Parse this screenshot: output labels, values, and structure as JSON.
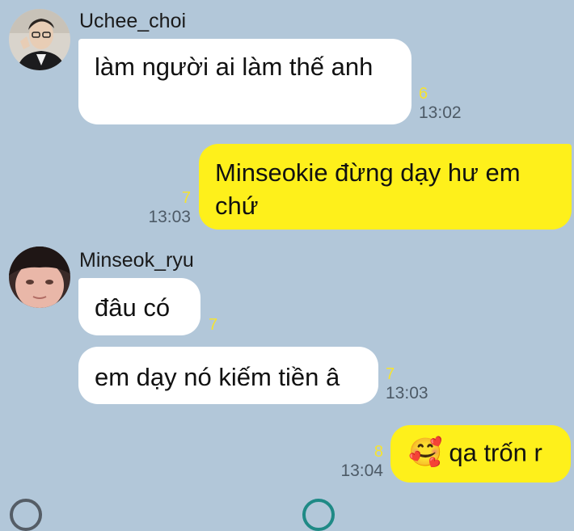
{
  "chat": {
    "messages": [
      {
        "sender": "Uchee_choi",
        "text": "làm người ai làm thế anh",
        "unread": "6",
        "time": "13:02"
      },
      {
        "sender": "",
        "text": "Minseokie đừng dạy hư em chứ",
        "unread": "7",
        "time": "13:03"
      },
      {
        "sender": "Minseok_ryu",
        "text": "đâu có",
        "unread": "7",
        "time": ""
      },
      {
        "sender": "",
        "text": "em dạy nó kiếm tiền â",
        "unread": "7",
        "time": "13:03"
      },
      {
        "sender": "",
        "text": "qa trốn r",
        "emoji": "🥰",
        "unread": "8",
        "time": "13:04"
      }
    ]
  },
  "colors": {
    "background": "#b2c7d9",
    "incoming_bubble": "#ffffff",
    "outgoing_bubble": "#fef01b",
    "unread_count": "#f6e330",
    "timestamp": "#4d5a66"
  }
}
